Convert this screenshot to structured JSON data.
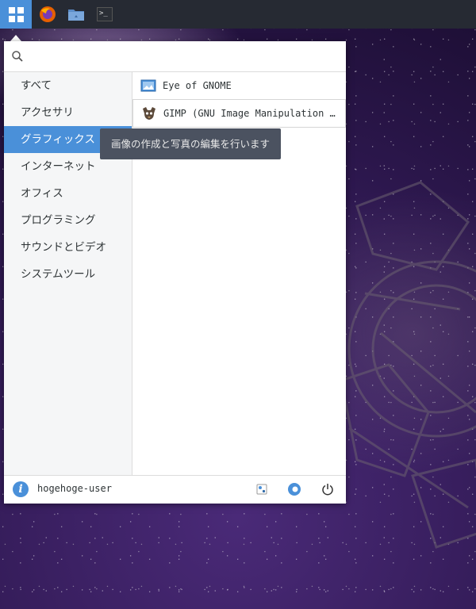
{
  "taskbar": {
    "items": [
      {
        "name": "start-menu",
        "icon": "app-grid-icon"
      },
      {
        "name": "firefox",
        "icon": "firefox-icon"
      },
      {
        "name": "files",
        "icon": "folder-icon"
      },
      {
        "name": "terminal",
        "icon": "terminal-icon",
        "glyph": ">_"
      }
    ]
  },
  "menu": {
    "search": {
      "value": "",
      "placeholder": ""
    },
    "categories": [
      {
        "label": "すべて"
      },
      {
        "label": "アクセサリ"
      },
      {
        "label": "グラフィックス",
        "active": true
      },
      {
        "label": "インターネット"
      },
      {
        "label": "オフィス"
      },
      {
        "label": "プログラミング"
      },
      {
        "label": "サウンドとビデオ"
      },
      {
        "label": "システムツール"
      }
    ],
    "apps": [
      {
        "label": "Eye of GNOME",
        "icon": "image-viewer-icon"
      },
      {
        "label": "GIMP (GNU Image Manipulation …",
        "icon": "gimp-icon"
      }
    ],
    "tooltip": "画像の作成と写真の編集を行います",
    "footer": {
      "user": "hogehoge-user",
      "buttons": [
        "settings-icon",
        "lock-screen-icon",
        "power-icon"
      ]
    }
  },
  "colors": {
    "accent": "#4a90d9",
    "taskbar": "#262a33",
    "tooltip": "#4b5260"
  }
}
